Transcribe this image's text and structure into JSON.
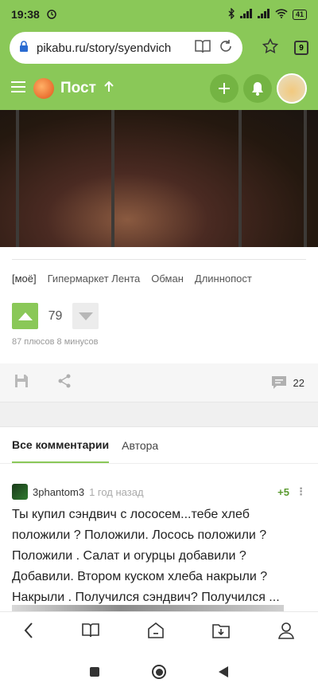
{
  "status": {
    "time": "19:38",
    "battery": "41"
  },
  "browser": {
    "url": "pikabu.ru/story/syendvich",
    "tab_count": "9"
  },
  "header": {
    "title": "Пост"
  },
  "tags": [
    "[моё]",
    "Гипермаркет Лента",
    "Обман",
    "Длиннопост"
  ],
  "votes": {
    "count": "79",
    "meta": "87 плюсов 8 минусов"
  },
  "actions": {
    "comments_count": "22"
  },
  "comment_tabs": {
    "all": "Все комментарии",
    "author": "Автора"
  },
  "comment": {
    "author": "3phantom3",
    "time": "1 год назад",
    "rating": "+5",
    "more": "⋮",
    "text": "Ты купил сэндвич с лососем...тебе хлеб положили ? Положили. Лосось положили ? Положили . Салат и огурцы добавили ? Добавили. Втором куском хлеба накрыли ? Накрыли . Получился сэндвич? Получился ..."
  },
  "colors": {
    "brand_green": "#8ac858",
    "rating_green": "#5a9a2f"
  }
}
